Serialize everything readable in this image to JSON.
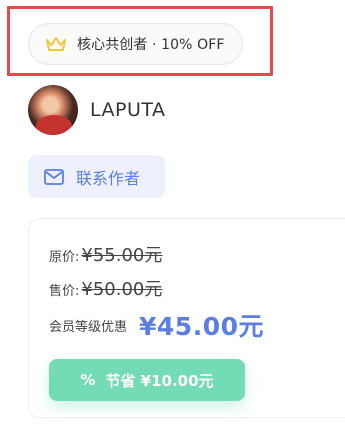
{
  "badge": {
    "text": "核心共创者 · 10% OFF",
    "icon": "crown-icon"
  },
  "author": {
    "name": "LAPUTA",
    "avatar": "avatar"
  },
  "contact": {
    "label": "联系作者",
    "icon": "mail-icon"
  },
  "pricing": {
    "original_label": "原价:",
    "original_price": "¥55.00元",
    "sale_label": "售价:",
    "sale_price": "¥50.00元",
    "member_label": "会员等级优惠",
    "member_price": "¥45.00元"
  },
  "save_button": {
    "icon": "percent-icon",
    "label": "节省 ¥10.00元"
  },
  "colors": {
    "accent": "#5b7fe1",
    "save_green": "#74dcb4",
    "highlight_red": "#e8474b",
    "crown_gold": "#f2c53d"
  }
}
